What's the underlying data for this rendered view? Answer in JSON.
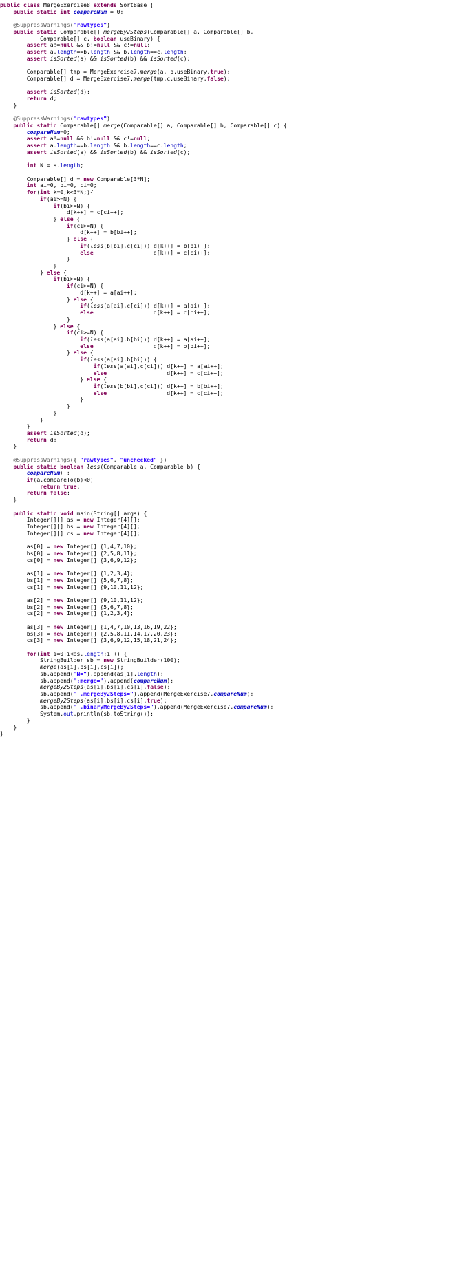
{
  "editor": {
    "language": "java",
    "class_name": "MergeExercise8",
    "superclass": "SortBase",
    "colors": {
      "background": "#ffffff",
      "keyword": "#7f0055",
      "string": "#2a00ff",
      "field": "#0000c0",
      "annotation": "#646464",
      "parameter": "#6a3e3e",
      "text": "#000000"
    }
  },
  "code": {
    "lines": [
      "public class MergeExercise8 extends SortBase {",
      "    public static int compareNum = 0;",
      "",
      "    @SuppressWarnings(\"rawtypes\")",
      "    public static Comparable[] mergeBy2Steps(Comparable[] a, Comparable[] b,",
      "            Comparable[] c, boolean useBinary) {",
      "        assert a!=null && b!=null && c!=null;",
      "        assert a.length==b.length && b.length==c.length;",
      "        assert isSorted(a) && isSorted(b) && isSorted(c);",
      "",
      "        Comparable[] tmp = MergeExercise7.merge(a, b,useBinary,true);",
      "        Comparable[] d = MergeExercise7.merge(tmp,c,useBinary,false);",
      "",
      "        assert isSorted(d);",
      "        return d;",
      "    }",
      "",
      "    @SuppressWarnings(\"rawtypes\")",
      "    public static Comparable[] merge(Comparable[] a, Comparable[] b, Comparable[] c) {",
      "        compareNum=0;",
      "        assert a!=null && b!=null && c!=null;",
      "        assert a.length==b.length && b.length==c.length;",
      "        assert isSorted(a) && isSorted(b) && isSorted(c);",
      "",
      "        int N = a.length;",
      "",
      "        Comparable[] d = new Comparable[3*N];",
      "        int ai=0, bi=0, ci=0;",
      "        for(int k=0;k<3*N;){",
      "            if(ai>=N) {",
      "                if(bi>=N) {",
      "                    d[k++] = c[ci++];",
      "                } else {",
      "                    if(ci>=N) {",
      "                        d[k++] = b[bi++];",
      "                    } else {",
      "                        if(less(b[bi],c[ci])) d[k++] = b[bi++];",
      "                        else                  d[k++] = c[ci++];",
      "                    }",
      "                }",
      "            } else {",
      "                if(bi>=N) {",
      "                    if(ci>=N) {",
      "                        d[k++] = a[ai++];",
      "                    } else {",
      "                        if(less(a[ai],c[ci])) d[k++] = a[ai++];",
      "                        else                  d[k++] = c[ci++];",
      "                    }",
      "                } else {",
      "                    if(ci>=N) {",
      "                        if(less(a[ai],b[bi])) d[k++] = a[ai++];",
      "                        else                  d[k++] = b[bi++];",
      "                    } else {",
      "                        if(less(a[ai],b[bi])) {",
      "                            if(less(a[ai],c[ci])) d[k++] = a[ai++];",
      "                            else                  d[k++] = c[ci++];",
      "                        } else {",
      "                            if(less(b[bi],c[ci])) d[k++] = b[bi++];",
      "                            else                  d[k++] = c[ci++];",
      "                        }",
      "                    }",
      "                }",
      "            }",
      "        }",
      "        assert isSorted(d);",
      "        return d;",
      "    }",
      "",
      "    @SuppressWarnings({ \"rawtypes\", \"unchecked\" })",
      "    public static boolean less(Comparable a, Comparable b) {",
      "        compareNum++;",
      "        if(a.compareTo(b)<0)",
      "            return true;",
      "        return false;",
      "    }",
      "",
      "    public static void main(String[] args) {",
      "        Integer[][] as = new Integer[4][];",
      "        Integer[][] bs = new Integer[4][];",
      "        Integer[][] cs = new Integer[4][];",
      "",
      "        as[0] = new Integer[] {1,4,7,10};",
      "        bs[0] = new Integer[] {2,5,8,11};",
      "        cs[0] = new Integer[] {3,6,9,12};",
      "",
      "        as[1] = new Integer[] {1,2,3,4};",
      "        bs[1] = new Integer[] {5,6,7,8};",
      "        cs[1] = new Integer[] {9,10,11,12};",
      "",
      "        as[2] = new Integer[] {9,10,11,12};",
      "        bs[2] = new Integer[] {5,6,7,8};",
      "        cs[2] = new Integer[] {1,2,3,4};",
      "",
      "        as[3] = new Integer[] {1,4,7,10,13,16,19,22};",
      "        bs[3] = new Integer[] {2,5,8,11,14,17,20,23};",
      "        cs[3] = new Integer[] {3,6,9,12,15,18,21,24};",
      "",
      "        for(int i=0;i<as.length;i++) {",
      "            StringBuilder sb = new StringBuilder(100);",
      "            merge(as[i],bs[i],cs[i]);",
      "            sb.append(\"N=\").append(as[i].length);",
      "            sb.append(\":merge=\").append(compareNum);",
      "            mergeBy2Steps(as[i],bs[i],cs[i],false);",
      "            sb.append(\" ,mergeBy2Steps=\").append(MergeExercise7.compareNum);",
      "            mergeBy2Steps(as[i],bs[i],cs[i],true);",
      "            sb.append(\" ,binaryMergeBy2Steps=\").append(MergeExercise7.compareNum);",
      "            System.out.println(sb.toString());",
      "        }",
      "    }",
      "}"
    ]
  }
}
